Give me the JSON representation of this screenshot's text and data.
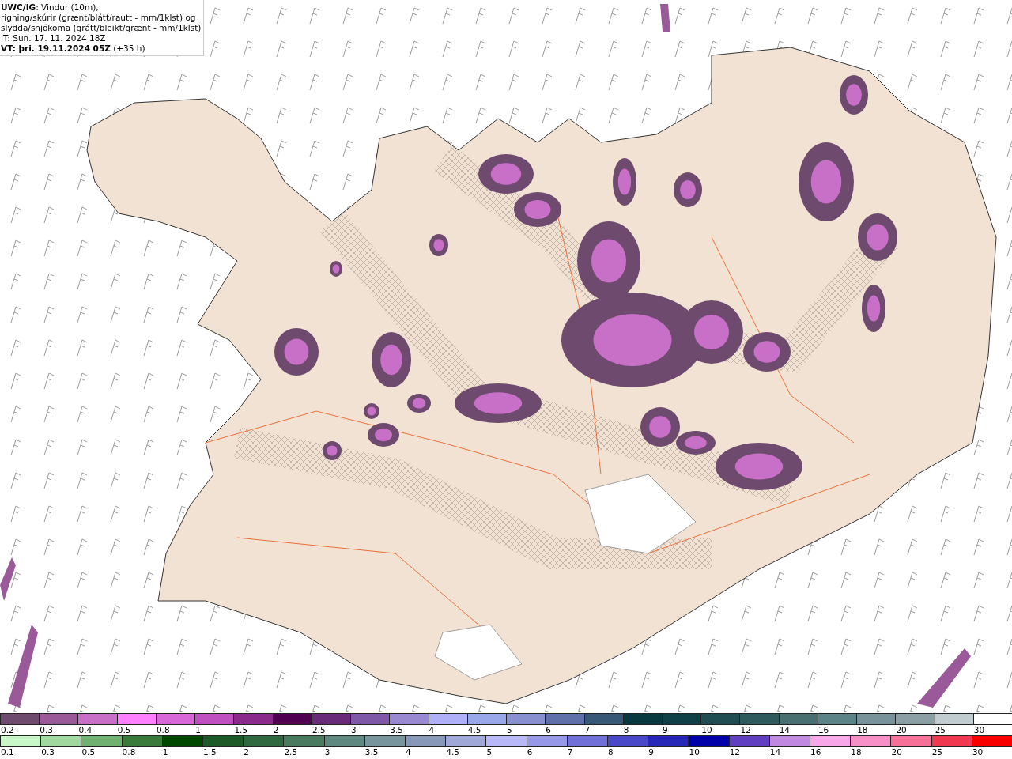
{
  "caption": {
    "description": [
      "**UWC/IG**: Vindur (10m),",
      "rigning/skúrir (grænt/blátt/rautt - mm/1klst) og",
      "slydda/snjókoma (grátt/bleikt/grænt - mm/1klst)"
    ],
    "issue_time": "IT: Sun. 17. 11. 2024 18Z",
    "valid_time": "**VT: þri. 19.11.2024 05Z** (+35 h)"
  },
  "legends": [
    {
      "items": [
        {
          "label": "0.2",
          "color": "#6e4a6e"
        },
        {
          "label": "0.3",
          "color": "#9a5a9a"
        },
        {
          "label": "0.4",
          "color": "#c870c8"
        },
        {
          "label": "0.5",
          "color": "#ff80ff"
        },
        {
          "label": "0.8",
          "color": "#d868d8"
        },
        {
          "label": "1",
          "color": "#c050c0"
        },
        {
          "label": "1.5",
          "color": "#8a2a8a"
        },
        {
          "label": "2",
          "color": "#500050"
        },
        {
          "label": "2.5",
          "color": "#6a2a7a"
        },
        {
          "label": "3",
          "color": "#8058a8"
        },
        {
          "label": "3.5",
          "color": "#9a88d0"
        },
        {
          "label": "4",
          "color": "#b0b0f8"
        },
        {
          "label": "4.5",
          "color": "#98a8e8"
        },
        {
          "label": "5",
          "color": "#8890d0"
        },
        {
          "label": "6",
          "color": "#6070a8"
        },
        {
          "label": "7",
          "color": "#385878"
        },
        {
          "label": "8",
          "color": "#083840"
        },
        {
          "label": "9",
          "color": "#104048"
        },
        {
          "label": "10",
          "color": "#204c54"
        },
        {
          "label": "12",
          "color": "#2e5a5e"
        },
        {
          "label": "14",
          "color": "#487070"
        },
        {
          "label": "16",
          "color": "#5a8488"
        },
        {
          "label": "18",
          "color": "#78949a"
        },
        {
          "label": "20",
          "color": "#8aa0a4"
        },
        {
          "label": "25",
          "color": "#c0ccd0"
        },
        {
          "label": "30",
          "color": "#ffffff"
        }
      ]
    },
    {
      "items": [
        {
          "label": "0.1",
          "color": "#c8f8c8"
        },
        {
          "label": "0.3",
          "color": "#a0d8a0"
        },
        {
          "label": "0.5",
          "color": "#70b070"
        },
        {
          "label": "0.8",
          "color": "#3a7a3a"
        },
        {
          "label": "1",
          "color": "#004800"
        },
        {
          "label": "1.5",
          "color": "#1e5a28"
        },
        {
          "label": "2",
          "color": "#306840"
        },
        {
          "label": "2.5",
          "color": "#4a7a60"
        },
        {
          "label": "3",
          "color": "#5e8880"
        },
        {
          "label": "3.5",
          "color": "#78949c"
        },
        {
          "label": "4",
          "color": "#8898b8"
        },
        {
          "label": "4.5",
          "color": "#a0a8d8"
        },
        {
          "label": "5",
          "color": "#b8b8f8"
        },
        {
          "label": "6",
          "color": "#9898e8"
        },
        {
          "label": "7",
          "color": "#7070d8"
        },
        {
          "label": "8",
          "color": "#4848c8"
        },
        {
          "label": "9",
          "color": "#2828b8"
        },
        {
          "label": "10",
          "color": "#0000a8"
        },
        {
          "label": "12",
          "color": "#6040c0"
        },
        {
          "label": "14",
          "color": "#c088e0"
        },
        {
          "label": "16",
          "color": "#f8a8e8"
        },
        {
          "label": "18",
          "color": "#f890c8"
        },
        {
          "label": "20",
          "color": "#f87098"
        },
        {
          "label": "25",
          "color": "#f03850"
        },
        {
          "label": "30",
          "color": "#f80000"
        }
      ]
    }
  ]
}
